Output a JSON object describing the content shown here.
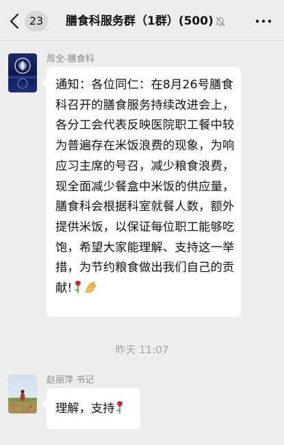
{
  "header": {
    "back_count": "23",
    "title": "膳食科服务群（1群）(500)",
    "muted": true
  },
  "messages": [
    {
      "sender": "周全-膳食科",
      "text": "通知：各位同仁：在8月26号膳食科召开的膳食服务持续改进会上，各分工会代表反映医院职工餐中较为普遍存在米饭浪费的现象，为响应习主席的号召，减少粮食浪费，现全面减少餐盒中米饭的供应量，膳食科会根据科室就餐人数，额外提供米饭，以保证每位职工能够吃饱，希望大家能理解、支持这一举措，为节约粮食做出我们自己的贡献!",
      "emojis": [
        "rose-emoji",
        "ok-hand-emoji"
      ]
    },
    {
      "sender": "赵丽萍 书记",
      "text": "理解，支持",
      "emojis": [
        "rose-emoji"
      ]
    }
  ],
  "timestamp": "昨天 11:07",
  "colors": {
    "background": "#ededed",
    "bubble": "#ffffff",
    "name_text": "#8a8a8a",
    "timestamp_text": "#a3a3a3"
  }
}
